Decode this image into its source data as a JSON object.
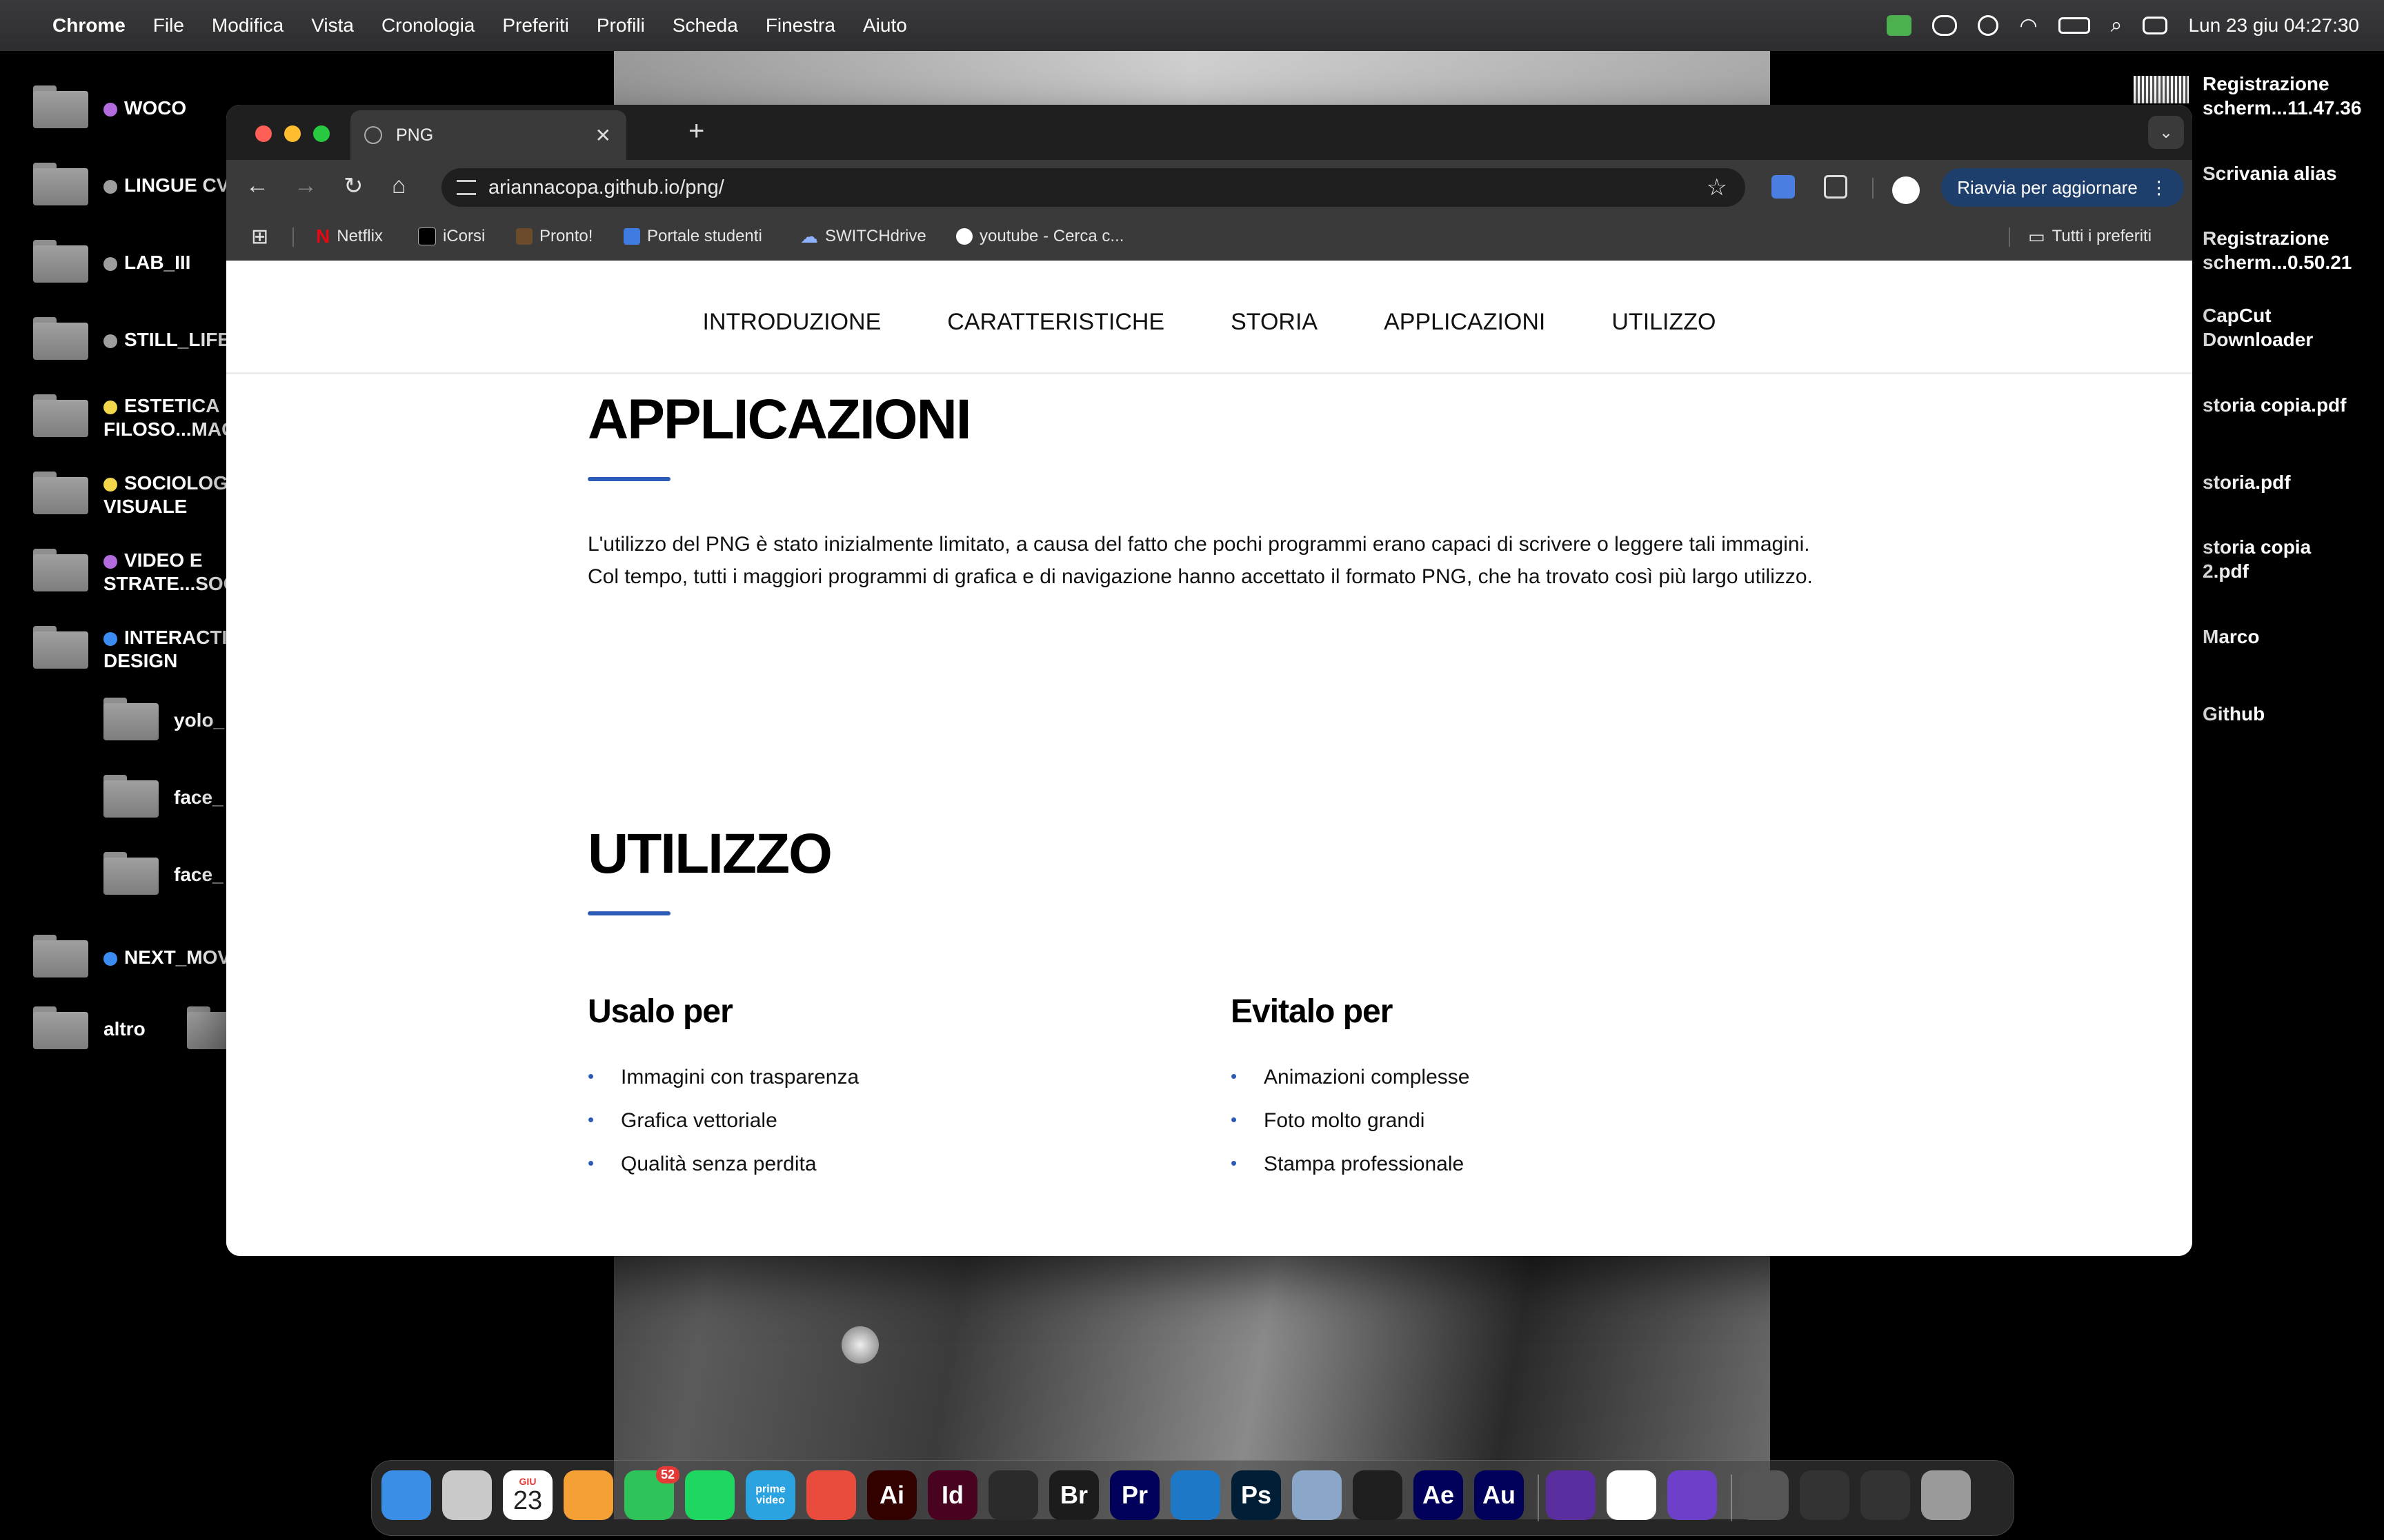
{
  "menubar": {
    "app_name": "Chrome",
    "menus": [
      "File",
      "Modifica",
      "Vista",
      "Cronologia",
      "Preferiti",
      "Profili",
      "Scheda",
      "Finestra",
      "Aiuto"
    ],
    "datetime": "Lun 23 giu  04:27:30"
  },
  "desktop_left": [
    {
      "label": "WOCO",
      "tag_color": "#b36be0"
    },
    {
      "label": "LINGUE CV",
      "tag_color": "#9e9e9e"
    },
    {
      "label": "LAB_III",
      "tag_color": "#9e9e9e"
    },
    {
      "label": "STILL_LIFE",
      "tag_color": "#9e9e9e"
    },
    {
      "label": "ESTETICA FILOSO...MAG",
      "tag_color": "#f2d74a"
    },
    {
      "label": "SOCIOLOG VISUALE",
      "tag_color": "#f2d74a"
    },
    {
      "label": "VIDEO E STRATE...SOC",
      "tag_color": "#b36be0"
    },
    {
      "label": "INTERACTI DESIGN",
      "tag_color": "#3b8cf0"
    },
    {
      "label": "yolo_"
    },
    {
      "label": "face_"
    },
    {
      "label": "face_"
    },
    {
      "label": "NEXT_MOV",
      "tag_color": "#3b8cf0"
    },
    {
      "label": "altro"
    }
  ],
  "desktop_right": [
    "Registrazione scherm...11.47.36",
    "Scrivania alias",
    "Registrazione scherm...0.50.21",
    "CapCut Downloader",
    "storia copia.pdf",
    "storia.pdf",
    "storia copia 2.pdf",
    "Marco",
    "Github"
  ],
  "browser": {
    "tab_title": "PNG",
    "url": "ariannacopa.github.io/png/",
    "update_button": "Riavvia per aggiornare",
    "bookmarks": [
      "Netflix",
      "iCorsi",
      "Pronto!",
      "Portale studenti",
      "SWITCHdrive",
      "youtube - Cerca c..."
    ],
    "all_bookmarks": "Tutti i preferiti"
  },
  "page": {
    "nav": [
      "INTRODUZIONE",
      "CARATTERISTICHE",
      "STORIA",
      "APPLICAZIONI",
      "UTILIZZO"
    ],
    "section1_title": "APPLICAZIONI",
    "section1_text": "L'utilizzo del PNG è stato inizialmente limitato, a causa del fatto che pochi programmi erano capaci di scrivere o leggere tali immagini. Col tempo, tutti i maggiori programmi di grafica e di navigazione hanno accettato il formato PNG, che ha trovato così più largo utilizzo.",
    "section2_title": "UTILIZZO",
    "use_title": "Usalo per",
    "use_items": [
      "Immagini con trasparenza",
      "Grafica vettoriale",
      "Qualità senza perdita"
    ],
    "avoid_title": "Evitalo per",
    "avoid_items": [
      "Animazioni complesse",
      "Foto molto grandi",
      "Stampa professionale"
    ]
  },
  "dock": {
    "calendar_month": "GIU",
    "calendar_day": "23",
    "whatsapp_badge": "52",
    "apps": [
      {
        "label": "",
        "color": "#3a8ee6",
        "icon": "finder-icon"
      },
      {
        "label": "",
        "color": "#c9c9c9",
        "icon": "launchpad-icon"
      },
      {
        "label": "",
        "color": "#ffffff",
        "icon": "calendar-icon"
      },
      {
        "label": "",
        "color": "#f4a035",
        "icon": "pages-icon"
      },
      {
        "label": "",
        "color": "#2fc459",
        "icon": "whatsapp-icon"
      },
      {
        "label": "",
        "color": "#1ed760",
        "icon": "spotify-icon"
      },
      {
        "label": "prime video",
        "color": "#2aa3e0",
        "icon": "prime-video-icon"
      },
      {
        "label": "",
        "color": "#e94b3c",
        "icon": "chrome-icon"
      },
      {
        "label": "Ai",
        "color": "#330000",
        "icon": "illustrator-icon"
      },
      {
        "label": "Id",
        "color": "#49021f",
        "icon": "indesign-icon"
      },
      {
        "label": "",
        "color": "#2b2b2b",
        "icon": "blender-icon"
      },
      {
        "label": "Br",
        "color": "#1c1c1c",
        "icon": "bridge-icon"
      },
      {
        "label": "Pr",
        "color": "#00005b",
        "icon": "premiere-icon"
      },
      {
        "label": "",
        "color": "#1e78c8",
        "icon": "vscode-icon"
      },
      {
        "label": "Ps",
        "color": "#001e36",
        "icon": "photoshop-icon"
      },
      {
        "label": "",
        "color": "#8aa6c8",
        "icon": "preview-icon"
      },
      {
        "label": "",
        "color": "#1e1e1e",
        "icon": "figma-icon"
      },
      {
        "label": "Ae",
        "color": "#00005b",
        "icon": "after-effects-icon"
      },
      {
        "label": "Au",
        "color": "#00005b",
        "icon": "audition-icon"
      },
      {
        "label": "",
        "color": "#5b2ea0",
        "icon": "firefox-icon"
      },
      {
        "label": "",
        "color": "#ffffff",
        "icon": "notes-icon"
      },
      {
        "label": "",
        "color": "#6e40c9",
        "icon": "github-desktop-icon"
      },
      {
        "label": "",
        "color": "#555555",
        "icon": "window-thumbnail-icon"
      },
      {
        "label": "",
        "color": "#333333",
        "icon": "window-thumbnail-icon"
      },
      {
        "label": "",
        "color": "#333333",
        "icon": "window-thumbnail-icon"
      },
      {
        "label": "",
        "color": "#9a9a9a",
        "icon": "trash-icon"
      }
    ]
  }
}
